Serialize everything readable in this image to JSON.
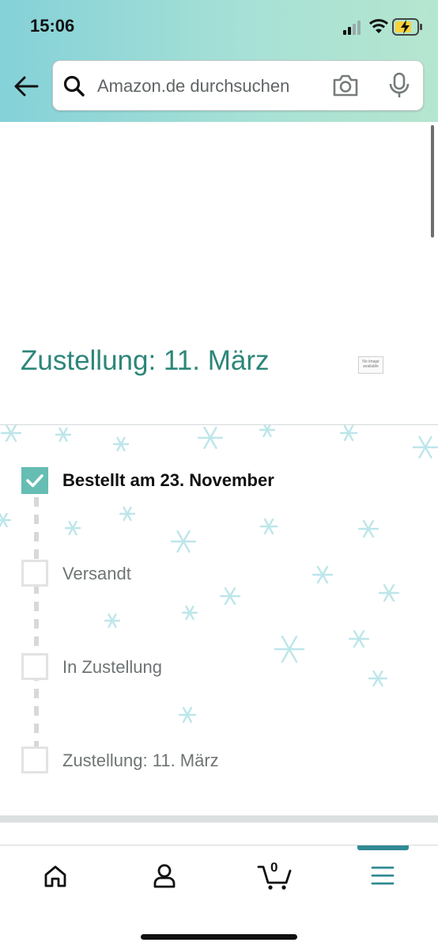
{
  "status_bar": {
    "time": "15:06"
  },
  "search": {
    "placeholder": "Amazon.de durchsuchen"
  },
  "delivery": {
    "heading": "Zustellung: 11. März",
    "image_placeholder": "No image available"
  },
  "tracking": {
    "steps": [
      {
        "label": "Bestellt am 23. November",
        "completed": true
      },
      {
        "label": "Versandt",
        "completed": false
      },
      {
        "label": "In Zustellung",
        "completed": false
      },
      {
        "label": "Zustellung: 11. März",
        "completed": false
      }
    ]
  },
  "tab_bar": {
    "items": [
      "home-icon",
      "account-icon",
      "cart-icon",
      "menu-icon"
    ],
    "cart_count": "0",
    "active": "menu"
  },
  "colors": {
    "accent_teal": "#2c8679",
    "check_fill": "#66bdb3",
    "tab_indicator": "#2f8a94"
  }
}
